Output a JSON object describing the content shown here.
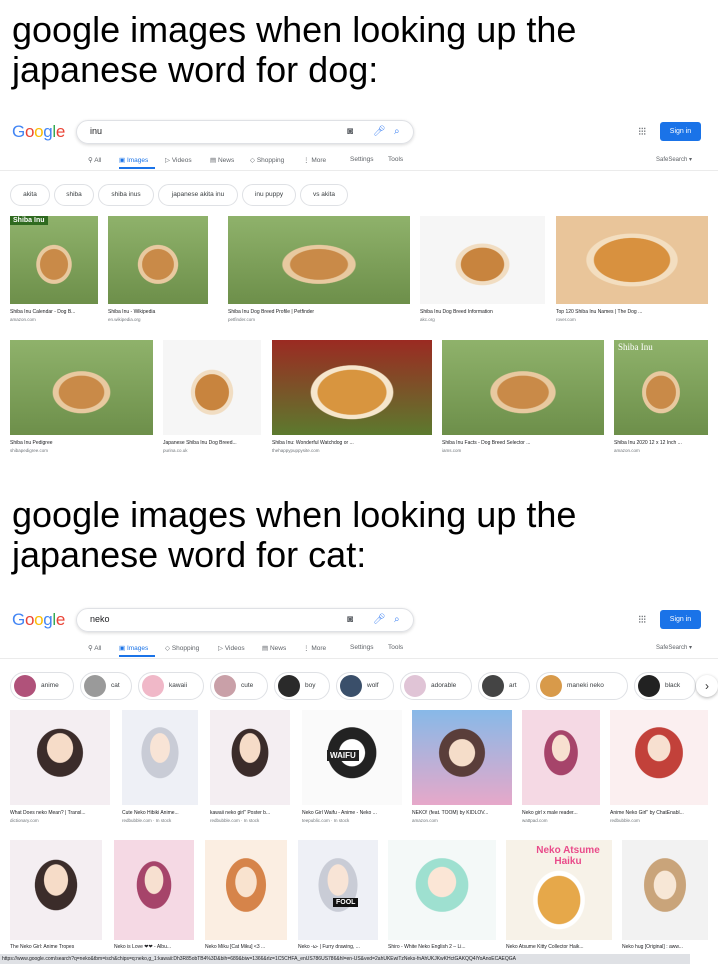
{
  "captions": {
    "top": "google images when looking up the japanese word for dog:",
    "bottom": "google images when looking up the japanese word for cat:"
  },
  "brand": {
    "logo_letters": [
      "G",
      "o",
      "o",
      "g",
      "l",
      "e"
    ]
  },
  "colors": {
    "accent": "#1a73e8",
    "border": "#dfe1e5",
    "muted": "#70757a"
  },
  "icons": {
    "camera": "camera-icon",
    "mic": "mic-icon",
    "search": "search-icon",
    "apps": "apps-grid-icon",
    "chevron": "chevron-right-icon"
  },
  "panel1": {
    "query": "inu",
    "signin": "Sign in",
    "tabs": [
      "All",
      "Images",
      "Videos",
      "News",
      "Shopping",
      "More",
      "Settings",
      "Tools"
    ],
    "safesearch": "SafeSearch ▾",
    "chips": [
      "akita",
      "shiba",
      "shiba inus",
      "japanese akita inu",
      "inu puppy",
      "vs akita"
    ],
    "results": [
      {
        "title": "Shiba Inu Calendar - Dog B...",
        "source": "amazon.com",
        "overlay": "Shiba Inu"
      },
      {
        "title": "Shiba Inu - Wikipedia",
        "source": "en.wikipedia.org"
      },
      {
        "title": "Shiba Inu Dog Breed Profile | Petfinder",
        "source": "petfinder.com"
      },
      {
        "title": "Shiba Inu Dog Breed Information",
        "source": "akc.org"
      },
      {
        "title": "Top 120 Shiba Inu Names | The Dog ...",
        "source": "rover.com"
      },
      {
        "title": "Shiba Inu Pedigree",
        "source": "shibapedigree.com"
      },
      {
        "title": "Japanese Shiba Inu Dog Breed...",
        "source": "purina.co.uk"
      },
      {
        "title": "Shiba Inu: Wonderful Watchdog or ...",
        "source": "thehappypuppysite.com"
      },
      {
        "title": "Shiba Inu Facts - Dog Breed Selector ...",
        "source": "iams.com"
      },
      {
        "title": "Shiba Inu 2020 12 x 12 Inch ...",
        "source": "amazon.com",
        "overlay": "Shiba Inu"
      }
    ]
  },
  "panel2": {
    "query": "neko",
    "signin": "Sign in",
    "tabs": [
      "All",
      "Images",
      "Shopping",
      "Videos",
      "News",
      "More",
      "Settings",
      "Tools"
    ],
    "safesearch": "SafeSearch ▾",
    "chips": [
      "anime",
      "cat",
      "kawaii",
      "cute",
      "boy",
      "wolf",
      "adorable",
      "art",
      "maneki neko",
      "black"
    ],
    "results": [
      {
        "title": "What Does neko Mean? | Transl...",
        "source": "dictionary.com"
      },
      {
        "title": "Cute Neko Hibiki Anime...",
        "source": "redbubble.com · In stock"
      },
      {
        "title": "kawaii neko girl\" Poster b...",
        "source": "redbubble.com · In stock"
      },
      {
        "title": "Neko Girl Waifu - Anime - Neko ...",
        "source": "teepublic.com · In stock",
        "overlay": "WAIFU"
      },
      {
        "title": "NEKO! (feat. TOOM) by KIDLOV...",
        "source": "amazon.com"
      },
      {
        "title": "Neko girl x male reader...",
        "source": "wattpad.com"
      },
      {
        "title": "Anime Neko Girl\" by ChatEnabl...",
        "source": "redbubble.com"
      },
      {
        "title": "The Neko Girl: Anime Tropes",
        "source": ""
      },
      {
        "title": "Neko is Love ❤❤ - Albu...",
        "source": ""
      },
      {
        "title": "Neko Miku [Cat Miku] <3 ...",
        "source": ""
      },
      {
        "title": "Neko -ω- | Furry drawing, ...",
        "source": "",
        "overlay": "FOOL"
      },
      {
        "title": "Shiro - White Neko English 2 – Li...",
        "source": ""
      },
      {
        "title": "Neko Atsume Kitty Collector Haik...",
        "source": "",
        "overlay": "Neko Atsume Haiku"
      },
      {
        "title": "Neko hug [Original] : aww...",
        "source": ""
      }
    ],
    "status_url": "https://www.google.com/search?q=neko&tbm=isch&chips=q:neko,g_1:kawaii:Dh3R85obTB4%3D&bih=689&biw=1366&rlz=1C5CHFA_enUS786US786&hl=en-US&ved=2ahUKEwiTzNeks-fnAhUKJKwKHctGAKQQ4lYoAnoECAEQGA"
  }
}
